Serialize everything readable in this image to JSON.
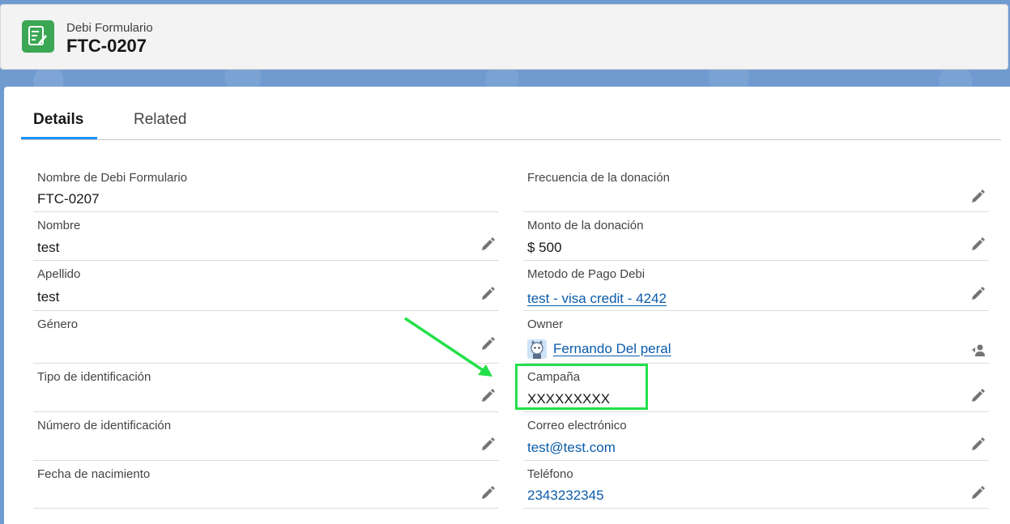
{
  "header": {
    "object_label": "Debi Formulario",
    "record_title": "FTC-0207",
    "icon": "form-icon"
  },
  "tabs": [
    {
      "label": "Details",
      "active": true
    },
    {
      "label": "Related",
      "active": false
    }
  ],
  "left_fields": [
    {
      "label": "Nombre de Debi Formulario",
      "value": "FTC-0207"
    },
    {
      "label": "Nombre",
      "value": "test"
    },
    {
      "label": "Apellido",
      "value": "test"
    },
    {
      "label": "Género",
      "value": ""
    },
    {
      "label": "Tipo de identificación",
      "value": ""
    },
    {
      "label": "Número de identificación",
      "value": ""
    },
    {
      "label": "Fecha de nacimiento",
      "value": ""
    }
  ],
  "right_fields": [
    {
      "label": "Frecuencia de la donación",
      "value": ""
    },
    {
      "label": "Monto de la donación",
      "value": "$ 500"
    },
    {
      "label": "Metodo de Pago Debi",
      "value": "test - visa credit - 4242"
    },
    {
      "label": "Owner",
      "value": "Fernando Del peral"
    },
    {
      "label": "Campaña",
      "value": "XXXXXXXXX"
    },
    {
      "label": "Correo electrónico",
      "value": "test@test.com"
    },
    {
      "label": "Teléfono",
      "value": "2343232345"
    }
  ],
  "colors": {
    "accent": "#1b96ff",
    "link": "#0b5cab",
    "highlight": "#22e04a",
    "icon_bg": "#3ba755"
  }
}
